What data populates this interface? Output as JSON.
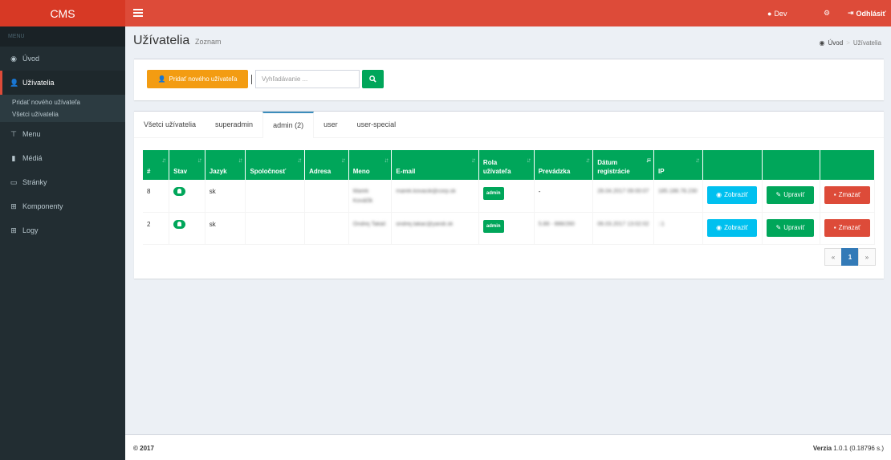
{
  "app": {
    "logo": "CMS"
  },
  "topbar": {
    "user": "Dev",
    "logout": "Odhlásiť"
  },
  "sidebar": {
    "header": "MENU",
    "items": [
      {
        "label": "Úvod",
        "icon": "dashboard-icon"
      },
      {
        "label": "Užívatelia",
        "icon": "user-plus-icon",
        "active": true
      },
      {
        "label": "Menu",
        "icon": "signpost-icon"
      },
      {
        "label": "Médiá",
        "icon": "file-icon"
      },
      {
        "label": "Stránky",
        "icon": "keyboard-icon"
      },
      {
        "label": "Komponenty",
        "icon": "sitemap-icon"
      },
      {
        "label": "Logy",
        "icon": "sitemap-icon"
      }
    ],
    "submenu": [
      "Pridať nového užívateľa",
      "Všetci užívatelia"
    ]
  },
  "header": {
    "title": "Užívatelia",
    "subtitle": "Zoznam"
  },
  "breadcrumb": {
    "home": "Úvod",
    "current": "Užívatelia"
  },
  "toolbar": {
    "add_label": "Pridať nového užívateľa",
    "search_placeholder": "Vyhľadávanie ..."
  },
  "tabs": [
    "Všetci užívatelia",
    "superadmin",
    "admin (2)",
    "user",
    "user-special"
  ],
  "table": {
    "columns": [
      "#",
      "Stav",
      "Jazyk",
      "Spoločnosť",
      "Adresa",
      "Meno",
      "E-mail",
      "Rola užívateľa",
      "Prevádzka",
      "Dátum registrácie",
      "IP"
    ],
    "rows": [
      {
        "id": "8",
        "lang": "sk",
        "company": "",
        "address": "",
        "name": "Marek Kováčik",
        "email": "marek.kovacik@corp.sk",
        "role": "admin",
        "branch": "-",
        "date": "28.04.2017 09:00:07",
        "ip": "185.188.78.230"
      },
      {
        "id": "2",
        "lang": "sk",
        "company": "",
        "address": "",
        "name": "Ondrej Takáč",
        "email": "ondrej.takac@yandi.sk",
        "role": "admin",
        "branch": "5.88 - 888/260",
        "date": "06.03.2017 13:02:02",
        "ip": "::1"
      }
    ],
    "actions": {
      "view": "Zobraziť",
      "edit": "Upraviť",
      "delete": "Zmazať"
    }
  },
  "pagination": {
    "prev": "«",
    "page": "1",
    "next": "»"
  },
  "footer": {
    "copyright": "© 2017",
    "version_label": "Verzia",
    "version": "1.0.1 (0.18796 s.)"
  },
  "colors": {
    "brand": "#dd4b39",
    "success": "#00a65a",
    "warning": "#f39c12",
    "info": "#00c0ef",
    "danger": "#dd4b39",
    "primary": "#337ab7"
  }
}
